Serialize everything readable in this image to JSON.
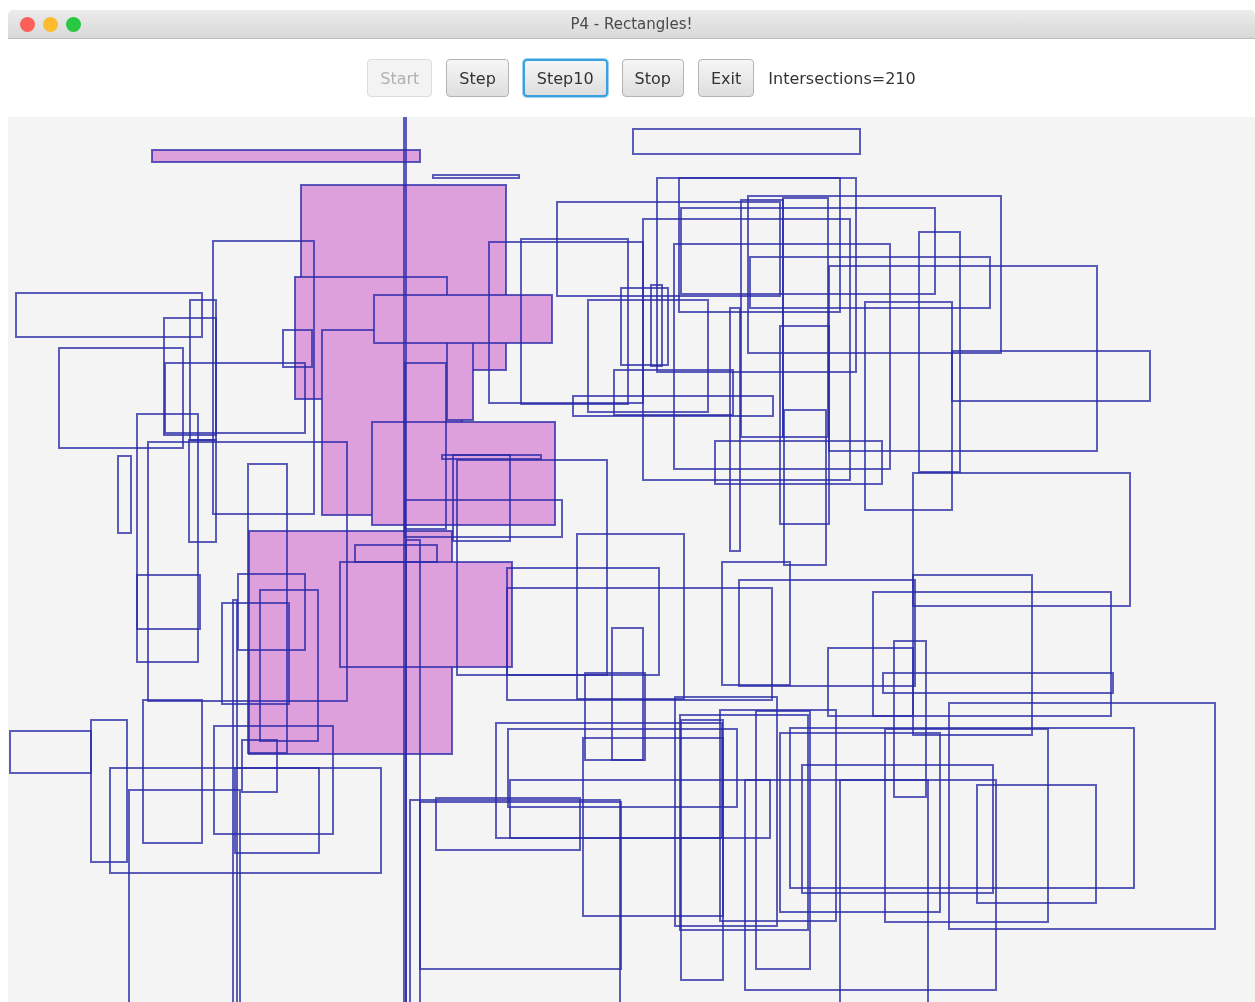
{
  "window": {
    "title": "P4 - Rectangles!"
  },
  "toolbar": {
    "buttons": [
      {
        "label": "Start",
        "disabled": true,
        "focused": false
      },
      {
        "label": "Step",
        "disabled": false,
        "focused": false
      },
      {
        "label": "Step10",
        "disabled": false,
        "focused": true
      },
      {
        "label": "Stop",
        "disabled": false,
        "focused": false
      },
      {
        "label": "Exit",
        "disabled": false,
        "focused": false
      }
    ],
    "status": "Intersections=210"
  }
}
